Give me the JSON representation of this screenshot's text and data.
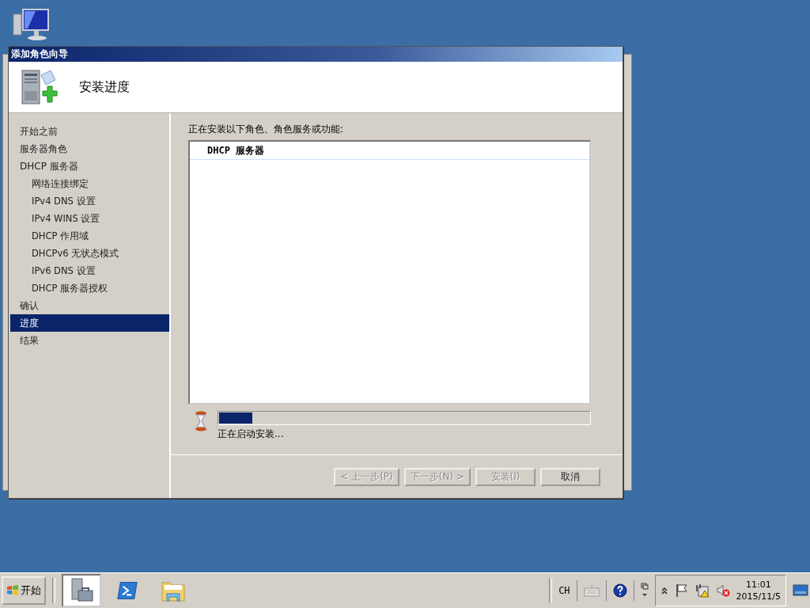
{
  "window": {
    "title": "添加角色向导"
  },
  "header": {
    "title": "安装进度"
  },
  "steps": [
    {
      "label": "开始之前",
      "selected": false
    },
    {
      "label": "服务器角色",
      "selected": false
    },
    {
      "label": "DHCP 服务器",
      "selected": false,
      "children": [
        {
          "label": "网络连接绑定",
          "selected": false
        },
        {
          "label": "IPv4 DNS 设置",
          "selected": false
        },
        {
          "label": "IPv4 WINS 设置",
          "selected": false
        },
        {
          "label": "DHCP 作用域",
          "selected": false
        },
        {
          "label": "DHCPv6 无状态模式",
          "selected": false
        },
        {
          "label": "IPv6 DNS 设置",
          "selected": false
        },
        {
          "label": "DHCP 服务器授权",
          "selected": false
        }
      ]
    },
    {
      "label": "确认",
      "selected": false
    },
    {
      "label": "进度",
      "selected": true
    },
    {
      "label": "结果",
      "selected": false
    }
  ],
  "content": {
    "prompt": "正在安装以下角色、角色服务或功能:",
    "items": [
      "DHCP 服务器"
    ],
    "progress": {
      "level": 0.09
    },
    "status": "正在启动安装..."
  },
  "buttons": [
    {
      "label": "< 上一步(P)",
      "disabled": true
    },
    {
      "label": "下一步(N) >",
      "disabled": true
    },
    {
      "label": "安装(I)",
      "disabled": true
    },
    {
      "label": "取消",
      "disabled": false
    }
  ],
  "taskbar": {
    "start": "开始",
    "apps": [
      {
        "kind": "server-manager",
        "selected": true
      },
      {
        "kind": "powershell",
        "selected": false
      },
      {
        "kind": "explorer",
        "selected": false
      }
    ],
    "language": "CH",
    "time": "11:01",
    "date": "2015/11/5"
  }
}
